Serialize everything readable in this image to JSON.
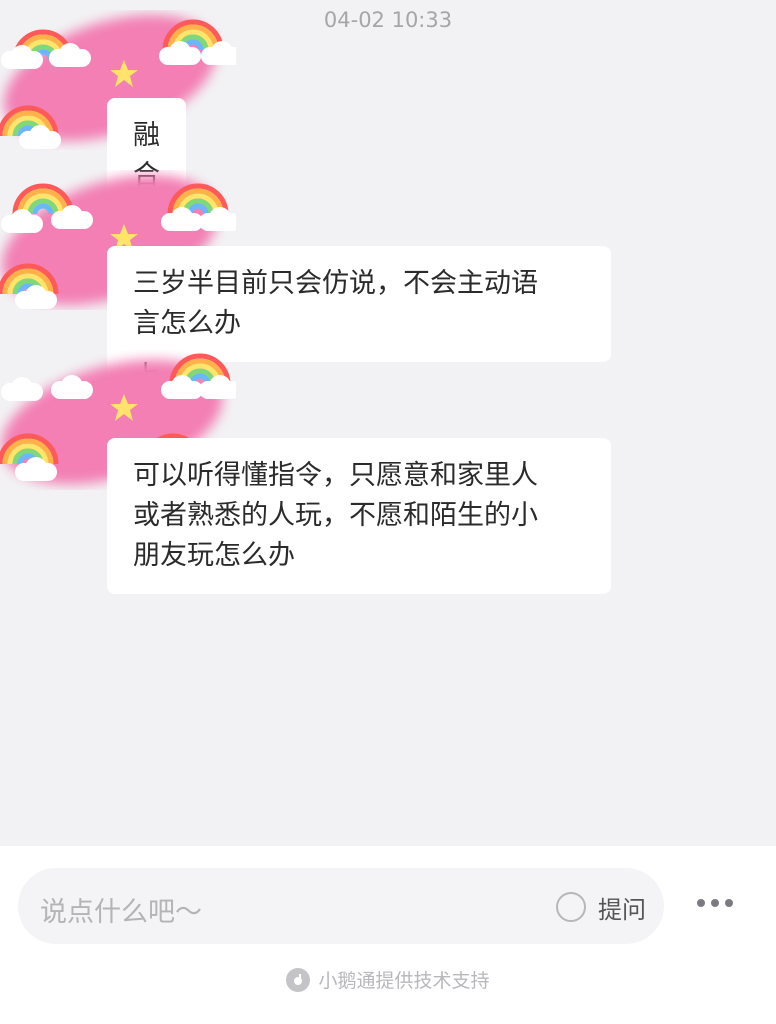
{
  "timestamp": "04-02 10:33",
  "messages": [
    {
      "text": "融合课如何线上"
    },
    {
      "text": "三岁半目前只会仿说，不会主动语\n言怎么办"
    },
    {
      "text": "可以听得懂指令，只愿意和家里人\n或者熟悉的人玩，不愿和陌生的小\n朋友玩怎么办"
    }
  ],
  "avatar_icon": "rainbow-clouds-star-avatar",
  "input": {
    "placeholder": "说点什么吧～"
  },
  "ask": {
    "label": "提问",
    "icon": "radio-circle-icon"
  },
  "more": {
    "icon": "more-dots-icon"
  },
  "footer": {
    "text": "小鹅通提供技术支持",
    "icon": "xiaoetong-logo-icon"
  },
  "colors": {
    "background": "#f2f2f4",
    "bubble": "#ffffff",
    "avatar_pink": "#f37fb4"
  }
}
